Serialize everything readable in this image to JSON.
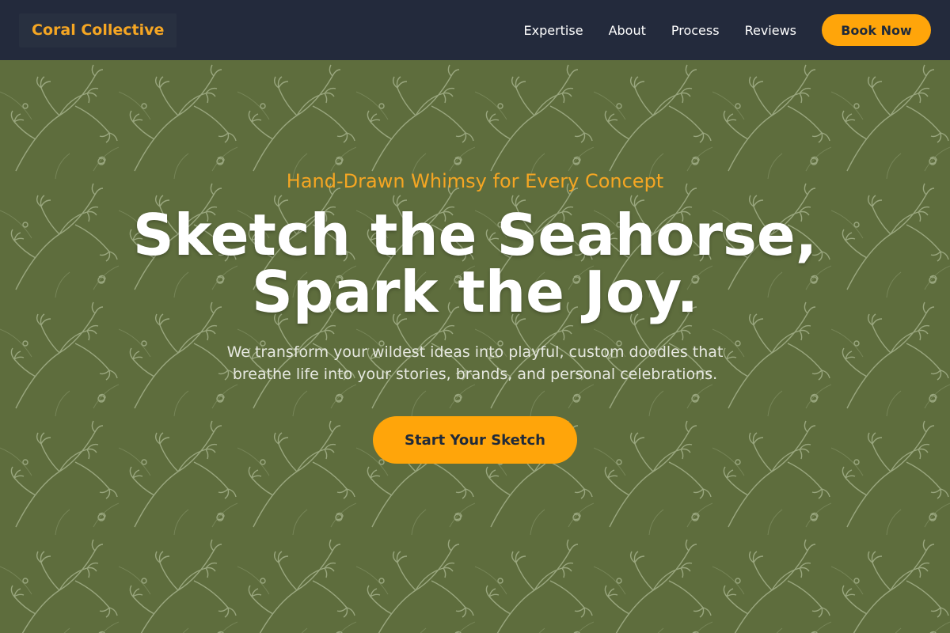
{
  "header": {
    "logo": "Coral Collective",
    "nav": [
      "Expertise",
      "About",
      "Process",
      "Reviews"
    ],
    "book_label": "Book Now"
  },
  "hero": {
    "tagline": "Hand-Drawn Whimsy for Every Concept",
    "headline_line1": "Sketch the Seahorse,",
    "headline_line2": "Spark the Joy.",
    "subtext_line1": "We transform your wildest ideas into playful, custom doodles that",
    "subtext_line2": "breathe life into your stories, brands, and personal celebrations.",
    "cta_label": "Start Your Sketch"
  },
  "colors": {
    "header_bg": "#232a3c",
    "accent": "#ffa50a",
    "hero_bg": "#5f6e3e"
  }
}
